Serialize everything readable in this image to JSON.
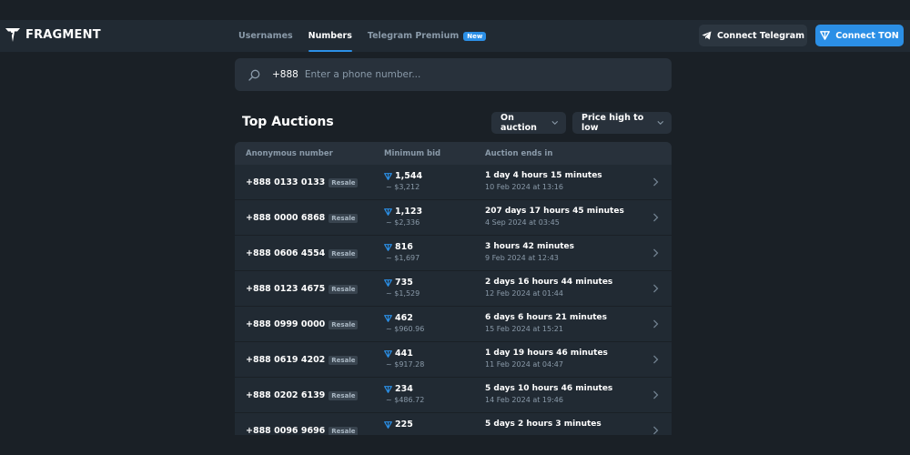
{
  "brand": {
    "name": "FRAGMENT"
  },
  "nav": {
    "tabs": [
      {
        "label": "Usernames",
        "active": false
      },
      {
        "label": "Numbers",
        "active": true
      },
      {
        "label": "Telegram Premium",
        "active": false,
        "badge": "New"
      }
    ],
    "connect_telegram": "Connect Telegram",
    "connect_ton": "Connect TON"
  },
  "search": {
    "prefix": "+888",
    "placeholder": "Enter a phone number...",
    "value": ""
  },
  "section": {
    "title": "Top Auctions",
    "filter_status": "On auction",
    "filter_sort": "Price high to low"
  },
  "table": {
    "headers": [
      "Anonymous number",
      "Minimum bid",
      "Auction ends in"
    ],
    "rows": [
      {
        "number": "+888 0133 0133",
        "tag": "Resale",
        "bid": "1,544",
        "usd": "~ $3,212",
        "ends": "1 day 4 hours 15 minutes",
        "date": "10 Feb 2024 at 13:16"
      },
      {
        "number": "+888 0000 6868",
        "tag": "Resale",
        "bid": "1,123",
        "usd": "~ $2,336",
        "ends": "207 days 17 hours 45 minutes",
        "date": "4 Sep 2024 at 03:45"
      },
      {
        "number": "+888 0606 4554",
        "tag": "Resale",
        "bid": "816",
        "usd": "~ $1,697",
        "ends": "3 hours 42 minutes",
        "date": "9 Feb 2024 at 12:43"
      },
      {
        "number": "+888 0123 4675",
        "tag": "Resale",
        "bid": "735",
        "usd": "~ $1,529",
        "ends": "2 days 16 hours 44 minutes",
        "date": "12 Feb 2024 at 01:44"
      },
      {
        "number": "+888 0999 0000",
        "tag": "Resale",
        "bid": "462",
        "usd": "~ $960.96",
        "ends": "6 days 6 hours 21 minutes",
        "date": "15 Feb 2024 at 15:21"
      },
      {
        "number": "+888 0619 4202",
        "tag": "Resale",
        "bid": "441",
        "usd": "~ $917.28",
        "ends": "1 day 19 hours 46 minutes",
        "date": "11 Feb 2024 at 04:47"
      },
      {
        "number": "+888 0202 6139",
        "tag": "Resale",
        "bid": "234",
        "usd": "~ $486.72",
        "ends": "5 days 10 hours 46 minutes",
        "date": "14 Feb 2024 at 19:46"
      },
      {
        "number": "+888 0096 9696",
        "tag": "Resale",
        "bid": "225",
        "usd": "",
        "ends": "5 days 2 hours 3 minutes",
        "date": ""
      }
    ]
  },
  "colors": {
    "accent": "#2b8fe6",
    "background": "#1a2026",
    "panel": "#212a33"
  }
}
